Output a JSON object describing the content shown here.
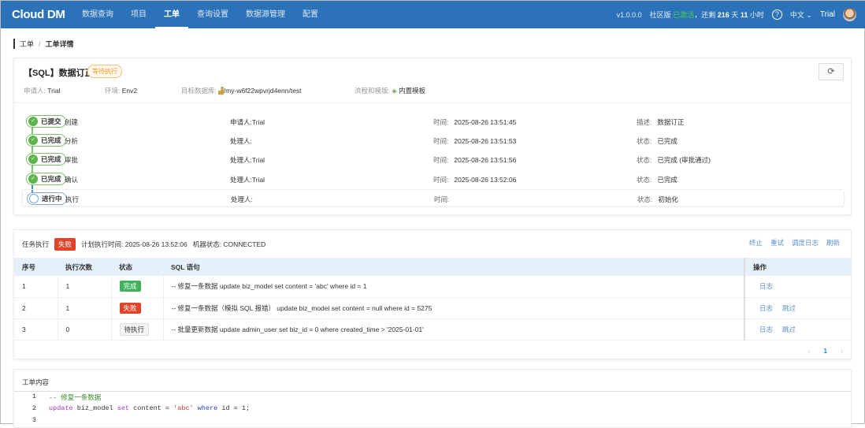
{
  "nav": {
    "logo": "Cloud DM",
    "menu": [
      "数据查询",
      "项目",
      "工单",
      "查询设置",
      "数据源管理",
      "配置"
    ],
    "active": 2,
    "version": "v1.0.0.0",
    "edition": "社区版",
    "activated": "已激活",
    "remain_prefix": "，还剩",
    "days": "216",
    "days_unit": "天",
    "hours": "11",
    "hours_unit": "小时",
    "help": "?",
    "lang": "中文 ⌄",
    "user": "Trial"
  },
  "breadcrumb": {
    "root": "工单",
    "sep": "/",
    "current": "工单详情"
  },
  "ticket": {
    "title": "【SQL】数据订正",
    "status": "等待执行",
    "applicant_label": "申请人:",
    "applicant": "Trial",
    "env_label": "环境:",
    "env": "Env2",
    "db_label": "目标数据库:",
    "db": "/my-w6f22wpvrjd4enn/test",
    "flow_label": "流程和模版:",
    "flow": "内置模板",
    "refresh": "⟳"
  },
  "timeline": [
    {
      "badge": "已提交",
      "stage": "创建",
      "who": "申请人:Trial",
      "time_label": "时间:",
      "time": "2025-08-26 13:51:45",
      "st_label": "描述:",
      "st": "数据订正"
    },
    {
      "badge": "已完成",
      "stage": "分析",
      "who": "处理人:",
      "time_label": "时间:",
      "time": "2025-08-26 13:51:53",
      "st_label": "状态:",
      "st": "已完成"
    },
    {
      "badge": "已完成",
      "stage": "审批",
      "who": "处理人:Trial",
      "time_label": "时间:",
      "time": "2025-08-26 13:51:56",
      "st_label": "状态:",
      "st": "已完成 (审批通过)"
    },
    {
      "badge": "已完成",
      "stage": "确认",
      "who": "处理人:Trial",
      "time_label": "时间:",
      "time": "2025-08-26 13:52:06",
      "st_label": "状态:",
      "st": "已完成"
    },
    {
      "badge": "进行中",
      "stage": "执行",
      "who": "处理人:",
      "time_label": "时间:",
      "time": "",
      "st_label": "状态:",
      "st": "初始化"
    }
  ],
  "task": {
    "label": "任务执行",
    "status": "失败",
    "plan": "计划执行时间: 2025-08-26 13:52:06",
    "machine": "机器状态: CONNECTED",
    "actions": [
      "终止",
      "重试",
      "调度日志",
      "刷新"
    ],
    "columns": [
      "序号",
      "执行次数",
      "状态",
      "SQL 语句",
      "操作"
    ],
    "rows": [
      {
        "no": "1",
        "count": "1",
        "status": "完成",
        "sql": "-- 修复一条数据 update biz_model set content = 'abc' where id = 1",
        "ops": [
          "日志"
        ]
      },
      {
        "no": "2",
        "count": "1",
        "status": "失败",
        "sql": "-- 修复一条数据（模拟 SQL 报错） update biz_model set content = null where id = 5275",
        "ops": [
          "日志",
          "跳过"
        ]
      },
      {
        "no": "3",
        "count": "0",
        "status": "待执行",
        "sql": "-- 批量更新数据 update admin_user set biz_id = 0 where created_time > '2025-01-01'",
        "ops": [
          "日志",
          "跳过"
        ]
      }
    ],
    "pager": {
      "prev": "‹",
      "page": "1",
      "next": "›"
    }
  },
  "content": {
    "title": "工单内容",
    "lines": [
      {
        "n": "1",
        "comment": "-- 修复一条数据"
      },
      {
        "n": "2",
        "kw1": "update",
        "t1": " biz_model ",
        "kw2": "set",
        "t2": " content = ",
        "str": "'abc'",
        "t3": " ",
        "kw3": "where",
        "t4": " id = 1;"
      },
      {
        "n": "3"
      }
    ]
  }
}
